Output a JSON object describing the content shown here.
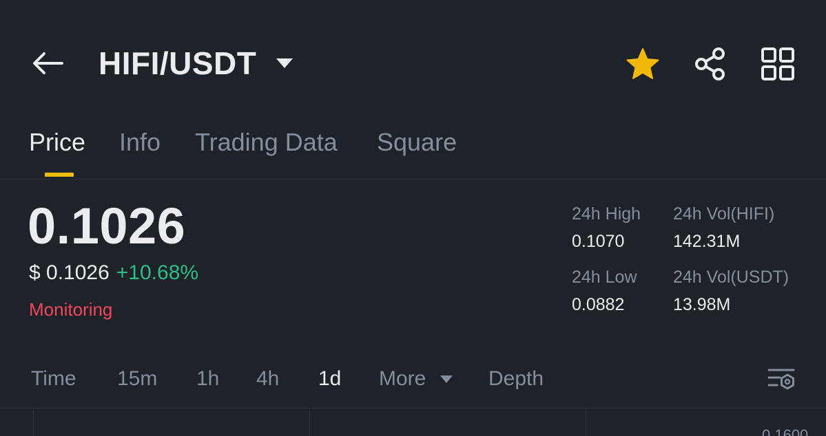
{
  "header": {
    "pair": "HIFI/USDT",
    "icons": [
      "back-arrow-icon",
      "caret-down-icon",
      "star-icon",
      "share-icon",
      "grid-menu-icon"
    ],
    "star_color": "#F0B90B"
  },
  "tabs": [
    {
      "label": "Price",
      "active": true
    },
    {
      "label": "Info",
      "active": false
    },
    {
      "label": "Trading Data",
      "active": false
    },
    {
      "label": "Square",
      "active": false
    }
  ],
  "price": {
    "last": "0.1026",
    "usd": "$ 0.1026",
    "change": "+10.68%",
    "status": "Monitoring"
  },
  "stats": {
    "high_label": "24h High",
    "high_value": "0.1070",
    "low_label": "24h Low",
    "low_value": "0.0882",
    "vol_base_label": "24h Vol(HIFI)",
    "vol_base_value": "142.31M",
    "vol_quote_label": "24h Vol(USDT)",
    "vol_quote_value": "13.98M"
  },
  "intervals": {
    "time": "Time",
    "m15": "15m",
    "h1": "1h",
    "h4": "4h",
    "d1": "1d",
    "more": "More",
    "depth": "Depth",
    "active": "1d"
  },
  "chart": {
    "axis_top_label": "0.1600"
  },
  "colors": {
    "background": "#1E2329",
    "accent": "#F0B90B",
    "up": "#2EBD85",
    "down": "#F6465D",
    "muted": "#848E9C",
    "text": "#EAECEF"
  }
}
